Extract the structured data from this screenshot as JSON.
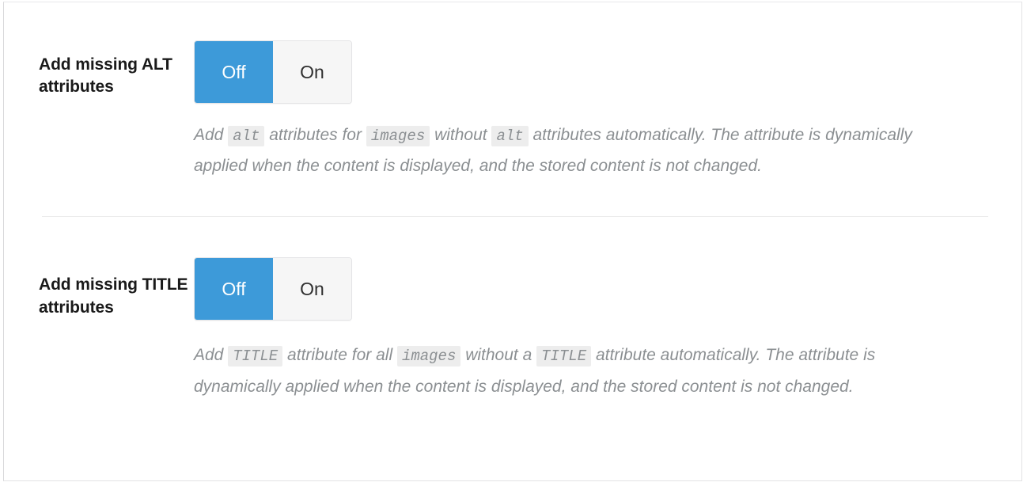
{
  "panel": {
    "name": "accessibility-settings-panel"
  },
  "settings": [
    {
      "id": "add-missing-alt-attributes",
      "label": "Add missing ALT attributes",
      "toggle": {
        "options": [
          "Off",
          "On"
        ],
        "selected": "Off",
        "off_label": "Off",
        "on_label": "On"
      },
      "description_parts": [
        {
          "type": "text",
          "value": "Add "
        },
        {
          "type": "code",
          "value": "alt"
        },
        {
          "type": "text",
          "value": " attributes for "
        },
        {
          "type": "code",
          "value": "images"
        },
        {
          "type": "text",
          "value": " without "
        },
        {
          "type": "code",
          "value": "alt"
        },
        {
          "type": "text",
          "value": " attributes automatically. The attribute is dynamically applied when the content is displayed, and the stored content is not changed."
        }
      ]
    },
    {
      "id": "add-missing-title-attributes",
      "label": "Add missing TITLE attributes",
      "toggle": {
        "options": [
          "Off",
          "On"
        ],
        "selected": "Off",
        "off_label": "Off",
        "on_label": "On"
      },
      "description_parts": [
        {
          "type": "text",
          "value": "Add "
        },
        {
          "type": "code",
          "value": "TITLE"
        },
        {
          "type": "text",
          "value": " attribute for all "
        },
        {
          "type": "code",
          "value": "images"
        },
        {
          "type": "text",
          "value": " without a "
        },
        {
          "type": "code",
          "value": "TITLE"
        },
        {
          "type": "text",
          "value": " attribute automatically. The attribute is dynamically applied when the content is displayed, and the stored content is not changed."
        }
      ]
    }
  ],
  "colors": {
    "toggle_active_bg": "#3d9ad9",
    "toggle_active_text": "#ffffff",
    "toggle_inactive_bg": "#f6f6f6",
    "toggle_inactive_text": "#2f2f2f",
    "label_text": "#1a1a1a",
    "description_text": "#8b8f92",
    "code_bg": "#ededed",
    "divider": "#ececec",
    "panel_border": "#e2e2e4"
  }
}
